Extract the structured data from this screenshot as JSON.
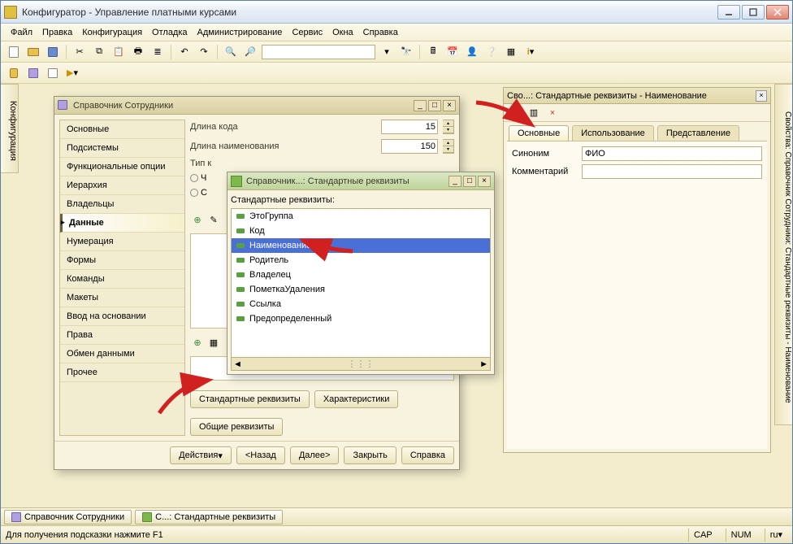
{
  "window": {
    "title": "Конфигуратор - Управление платными курсами"
  },
  "menu": [
    "Файл",
    "Правка",
    "Конфигурация",
    "Отладка",
    "Администрирование",
    "Сервис",
    "Окна",
    "Справка"
  ],
  "vtab_left": "Конфигурация",
  "vtab_right": "Свойства: Справочник Сотрудники: Стандартные реквизиты - Наименование",
  "dlg_main": {
    "title": "Справочник Сотрудники",
    "nav": [
      "Основные",
      "Подсистемы",
      "Функциональные опции",
      "Иерархия",
      "Владельцы",
      "Данные",
      "Нумерация",
      "Формы",
      "Команды",
      "Макеты",
      "Ввод на основании",
      "Права",
      "Обмен данными",
      "Прочее"
    ],
    "nav_active_index": 5,
    "code_len_label": "Длина кода",
    "code_len_value": "15",
    "name_len_label": "Длина наименования",
    "name_len_value": "150",
    "tip_label": "Тип к",
    "btn_std": "Стандартные реквизиты",
    "btn_char": "Характеристики",
    "btn_common": "Общие реквизиты",
    "footer": {
      "actions": "Действия",
      "back": "<Назад",
      "next": "Далее>",
      "close": "Закрыть",
      "help": "Справка"
    }
  },
  "dlg_sub": {
    "title": "Справочник...: Стандартные реквизиты",
    "label": "Стандартные реквизиты:",
    "items": [
      "ЭтоГруппа",
      "Код",
      "Наименование",
      "Родитель",
      "Владелец",
      "ПометкаУдаления",
      "Ссылка",
      "Предопределенный"
    ],
    "selected_index": 2
  },
  "props": {
    "title": "Сво...: Стандартные реквизиты - Наименование",
    "tabs": [
      "Основные",
      "Использование",
      "Представление"
    ],
    "active_tab": 0,
    "synonym_label": "Синоним",
    "synonym_value": "ФИО",
    "comment_label": "Комментарий",
    "comment_value": ""
  },
  "taskbar": {
    "tab1": "Справочник Сотрудники",
    "tab2": "С...: Стандартные реквизиты"
  },
  "status": {
    "hint": "Для получения подсказки нажмите F1",
    "cap": "CAP",
    "num": "NUM",
    "lang": "ru"
  }
}
